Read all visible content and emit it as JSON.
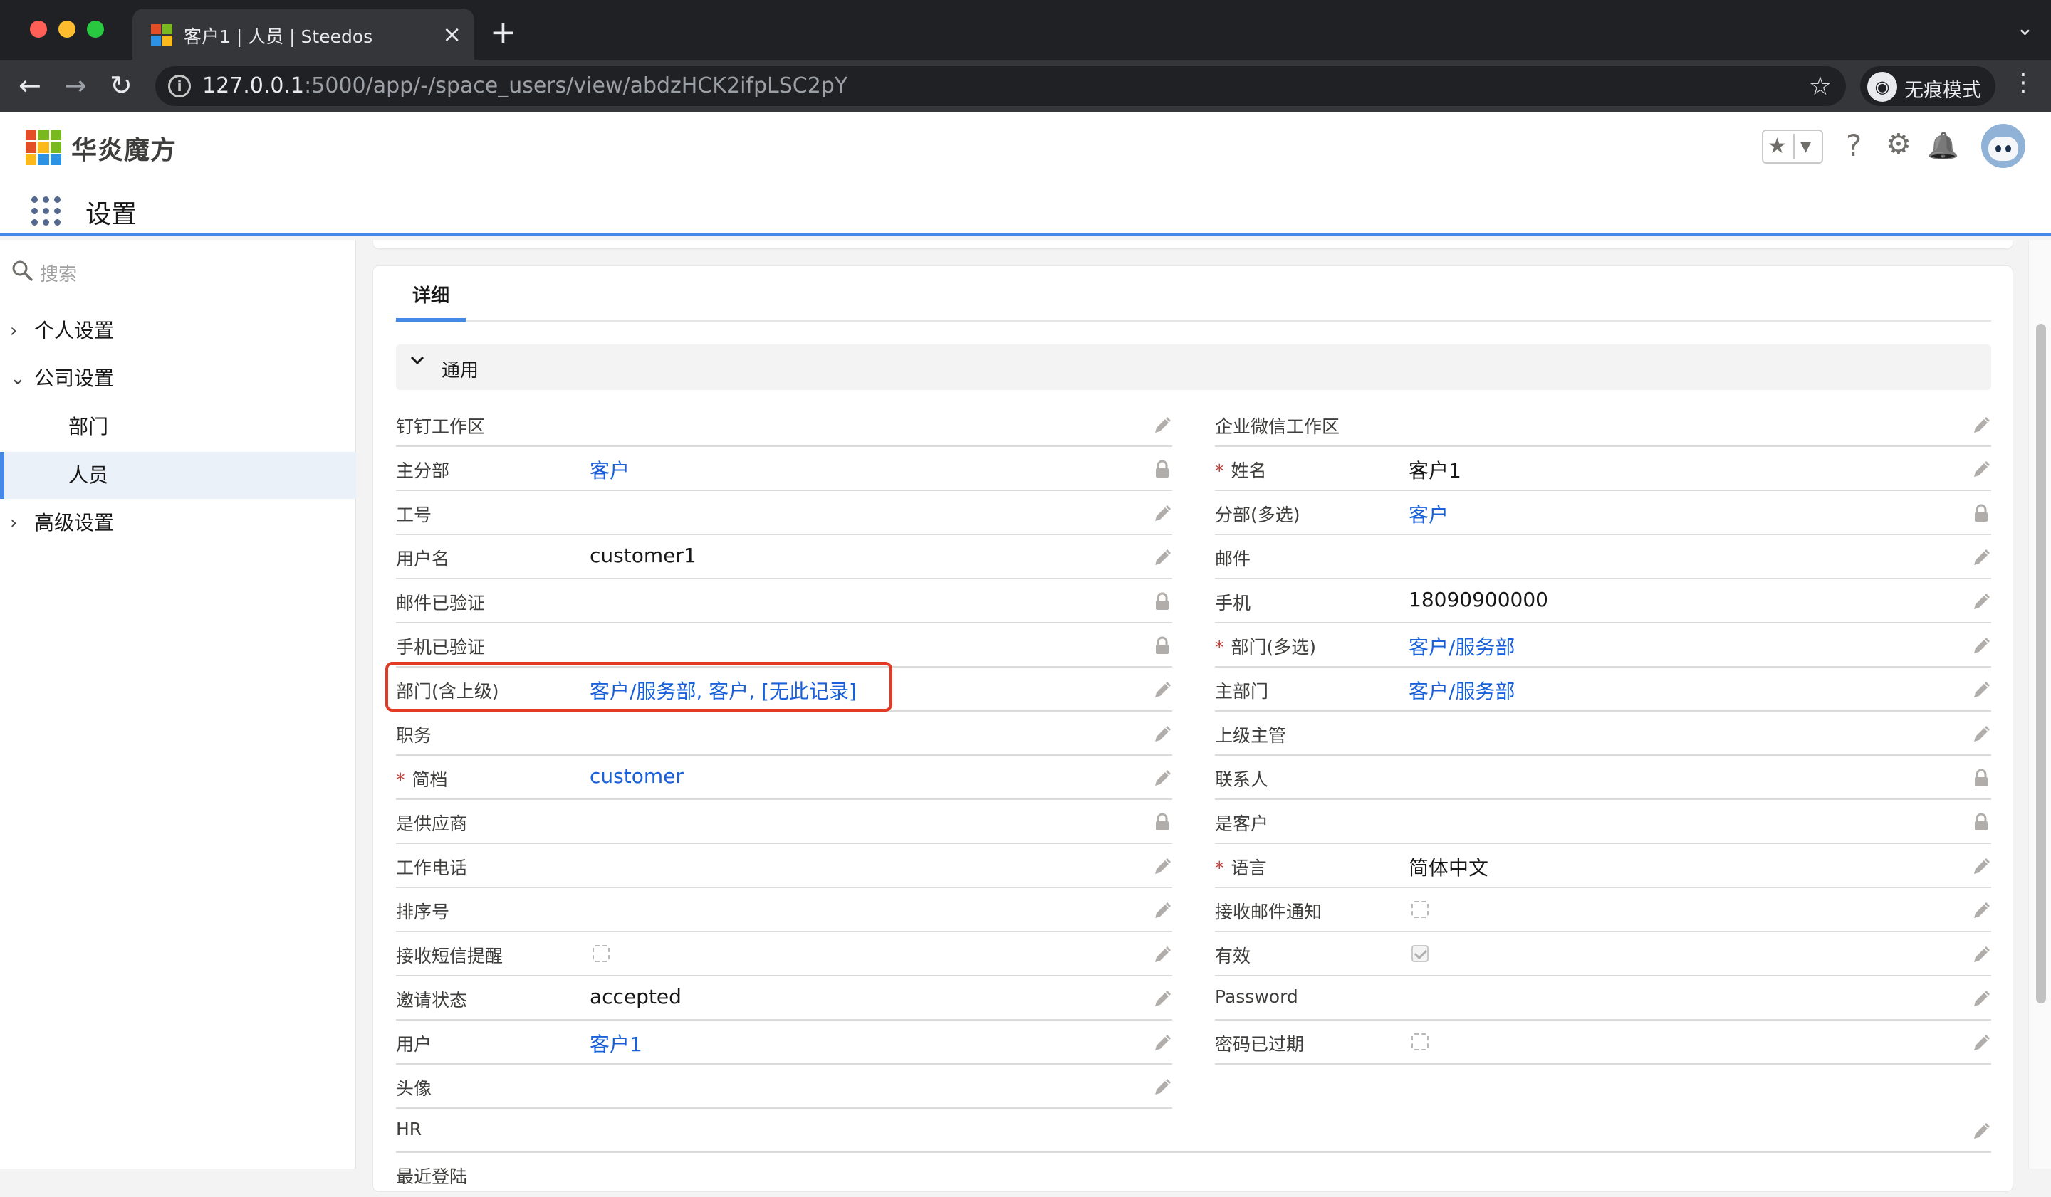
{
  "browser": {
    "tab_title": "客户1 | 人员 | Steedos",
    "tab_close": "×",
    "new_tab": "+",
    "tab_list": "⌄",
    "url_host": "127.0.0.1",
    "url_rest": ":5000/app/-/space_users/view/abdzHCK2ifpLSC2pY",
    "incognito_label": "无痕模式",
    "back": "←",
    "forward": "→",
    "reload": "↻",
    "info": "i",
    "star": "☆",
    "menu": "⋮",
    "traffic_colors": [
      "#ff5f57",
      "#febc2e",
      "#28c840"
    ]
  },
  "header": {
    "brand": "华炎魔方",
    "app_title": "设置",
    "fav_star": "★",
    "fav_dropdown": "▾",
    "help": "?",
    "settings": "⚙",
    "notifications": "🔔",
    "accent_color": "#4489e8"
  },
  "sidebar": {
    "search_placeholder": "搜索",
    "items": [
      {
        "label": "个人设置",
        "chevron": "›"
      },
      {
        "label": "公司设置",
        "chevron": "⌄"
      },
      {
        "label": "部门"
      },
      {
        "label": "人员"
      },
      {
        "label": "高级设置",
        "chevron": "›"
      }
    ]
  },
  "detail": {
    "tab_label": "详细",
    "section_label": "通用",
    "left_fields": [
      {
        "label": "钉钉工作区",
        "value": "",
        "action": "edit-icon"
      },
      {
        "label": "主分部",
        "value": "客户",
        "link": true,
        "action": "lock-icon"
      },
      {
        "label": "工号",
        "value": "",
        "action": "edit-icon"
      },
      {
        "label": "用户名",
        "value": "customer1",
        "action": "edit-icon"
      },
      {
        "label": "邮件已验证",
        "value": "",
        "action": "lock-icon"
      },
      {
        "label": "手机已验证",
        "value": "",
        "action": "lock-icon"
      },
      {
        "label": "部门(含上级)",
        "value": "客户/服务部, 客户, [无此记录]",
        "link": true,
        "action": "edit-icon"
      },
      {
        "label": "职务",
        "value": "",
        "action": "edit-icon"
      },
      {
        "label": "简档",
        "value": "customer",
        "link": true,
        "required": true,
        "action": "edit-icon"
      },
      {
        "label": "是供应商",
        "value": "",
        "action": "lock-icon"
      },
      {
        "label": "工作电话",
        "value": "",
        "action": "edit-icon"
      },
      {
        "label": "排序号",
        "value": "",
        "action": "edit-icon"
      },
      {
        "label": "接收短信提醒",
        "checkbox": "unchecked",
        "action": "edit-icon"
      },
      {
        "label": "邀请状态",
        "value": "accepted",
        "action": "edit-icon"
      },
      {
        "label": "用户",
        "value": "客户1",
        "link": true,
        "action": "edit-icon"
      },
      {
        "label": "头像",
        "value": "",
        "action": "edit-icon"
      }
    ],
    "right_fields": [
      {
        "label": "企业微信工作区",
        "value": "",
        "action": "edit-icon"
      },
      {
        "label": "姓名",
        "value": "客户1",
        "required": true,
        "action": "edit-icon"
      },
      {
        "label": "分部(多选)",
        "value": "客户",
        "link": true,
        "action": "lock-icon"
      },
      {
        "label": "邮件",
        "value": "",
        "action": "edit-icon"
      },
      {
        "label": "手机",
        "value": "18090900000",
        "action": "edit-icon"
      },
      {
        "label": "部门(多选)",
        "value": "客户/服务部",
        "link": true,
        "required": true,
        "action": "edit-icon"
      },
      {
        "label": "主部门",
        "value": "客户/服务部",
        "link": true,
        "action": "edit-icon"
      },
      {
        "label": "上级主管",
        "value": "",
        "action": "edit-icon"
      },
      {
        "label": "联系人",
        "value": "",
        "action": "lock-icon"
      },
      {
        "label": "是客户",
        "value": "",
        "action": "lock-icon"
      },
      {
        "label": "语言",
        "value": "简体中文",
        "required": true,
        "action": "edit-icon"
      },
      {
        "label": "接收邮件通知",
        "checkbox": "unchecked",
        "action": "edit-icon"
      },
      {
        "label": "有效",
        "checkbox": "checked",
        "action": "edit-icon"
      },
      {
        "label": "Password",
        "value": "",
        "action": "edit-icon"
      },
      {
        "label": "密码已过期",
        "checkbox": "unchecked",
        "action": "edit-icon"
      }
    ],
    "full_width_field": {
      "label": "HR",
      "value": "",
      "action": "edit-icon"
    },
    "partial_field": {
      "label": "最近登陆"
    }
  }
}
